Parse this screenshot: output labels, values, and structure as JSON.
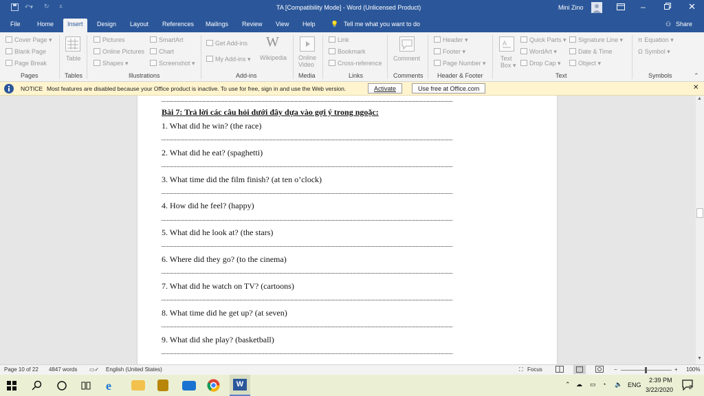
{
  "window": {
    "title": "TA [Compatibility Mode] - Word (Unlicensed Product)",
    "user": "Mini Zino"
  },
  "tabs": [
    "File",
    "Home",
    "Insert",
    "Design",
    "Layout",
    "References",
    "Mailings",
    "Review",
    "View",
    "Help"
  ],
  "active_tab": "Insert",
  "tell_me": "Tell me what you want to do",
  "share": "Share",
  "ribbon": {
    "pages": {
      "items": [
        "Cover Page",
        "Blank Page",
        "Page Break"
      ],
      "label": "Pages"
    },
    "tables": {
      "item": "Table",
      "label": "Tables"
    },
    "illustrations": {
      "items": [
        "Pictures",
        "Online Pictures",
        "Shapes",
        "SmartArt",
        "Chart",
        "Screenshot"
      ],
      "label": "Illustrations"
    },
    "addins": {
      "items": [
        "Get Add-ins",
        "My Add-ins",
        "Wikipedia"
      ],
      "label": "Add-ins"
    },
    "media": {
      "item1": "Online",
      "item2": "Video",
      "label": "Media"
    },
    "links": {
      "items": [
        "Link",
        "Bookmark",
        "Cross-reference"
      ],
      "label": "Links"
    },
    "comments": {
      "item": "Comment",
      "label": "Comments"
    },
    "header_footer": {
      "items": [
        "Header",
        "Footer",
        "Page Number"
      ],
      "label": "Header & Footer"
    },
    "text": {
      "textbox1": "Text",
      "textbox2": "Box",
      "items": [
        "Quick Parts",
        "WordArt",
        "Drop Cap",
        "Signature Line",
        "Date & Time",
        "Object"
      ],
      "label": "Text"
    },
    "symbols": {
      "items": [
        "Equation",
        "Symbol"
      ],
      "label": "Symbols"
    }
  },
  "notice": {
    "label": "NOTICE",
    "message": "Most features are disabled because your Office product is inactive. To use for free, sign in and use the Web version.",
    "activate": "Activate",
    "use_free": "Use free at Office.com"
  },
  "document": {
    "heading": "Bài 7: Trả lời các câu hỏi dưới đây dựa vào gợi ý trong ngoặc:",
    "questions": [
      "1. What did he win? (the race)",
      "2. What did he eat? (spaghetti)",
      "3. What time did the film finish? (at ten o’clock)",
      "4. How did he feel? (happy)",
      "5. What did he look at? (the stars)",
      "6. Where did they go? (to the cinema)",
      "7. What did he watch on TV? (cartoons)",
      "8. What time did he get up? (at seven)",
      "9. What did she play? (basketball)"
    ]
  },
  "status": {
    "page": "Page 10 of 22",
    "words": "4847 words",
    "language": "English (United States)",
    "focus": "Focus",
    "zoom_minus": "−",
    "zoom_plus": "+",
    "zoom": "100%"
  },
  "taskbar": {
    "lang": "ENG",
    "time": "2:39 PM",
    "date": "3/22/2020",
    "notifications": "2"
  },
  "colors": {
    "word_blue": "#2b579a",
    "notice_bg": "#fff4ce",
    "taskbar_bg": "#ebf0d4"
  }
}
